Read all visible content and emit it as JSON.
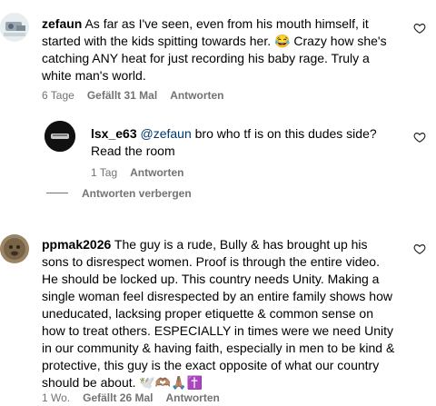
{
  "comments": [
    {
      "username": "zefaun",
      "text": "As far as I've seen, even from his mouth himself, it started with the kids spitting towards her. 😂 Crazy how she's catching ANY heat for just recording his baby rage. Truly a white man's world.",
      "time": "6 Tage",
      "likes": "Gefällt 31 Mal",
      "reply": "Antworten"
    },
    {
      "username": "lsx_e63",
      "mention": "@zefaun",
      "text": "bro who tf is on this dudes side? Read the room",
      "time": "1 Tag",
      "reply": "Antworten"
    },
    {
      "username": "ppmak2026",
      "text": "The guy is a rude, Bully & has brought up his sons to disrespect women. Proof is through the entire video. He should be locked up. This country needs Unity. Making a single woman feel disrespected by an entire family shows how uneducated, lacksing proper etiquette & common sense on how to treat others. ESPECIALLY in times were we need Unity in our community & having faith, especially in men to be kind & protective, this guy is the exact opposite of what our country should be about. 🕊️🫶🏽🙏🏽✝️",
      "time": "1 Wo.",
      "likes": "Gefällt 26 Mal",
      "reply": "Antworten"
    }
  ],
  "hide_replies": "Antworten verbergen",
  "icons": {
    "like": "heart-outline-icon"
  },
  "colors": {
    "meta": "#737373",
    "mention": "#00376b"
  }
}
